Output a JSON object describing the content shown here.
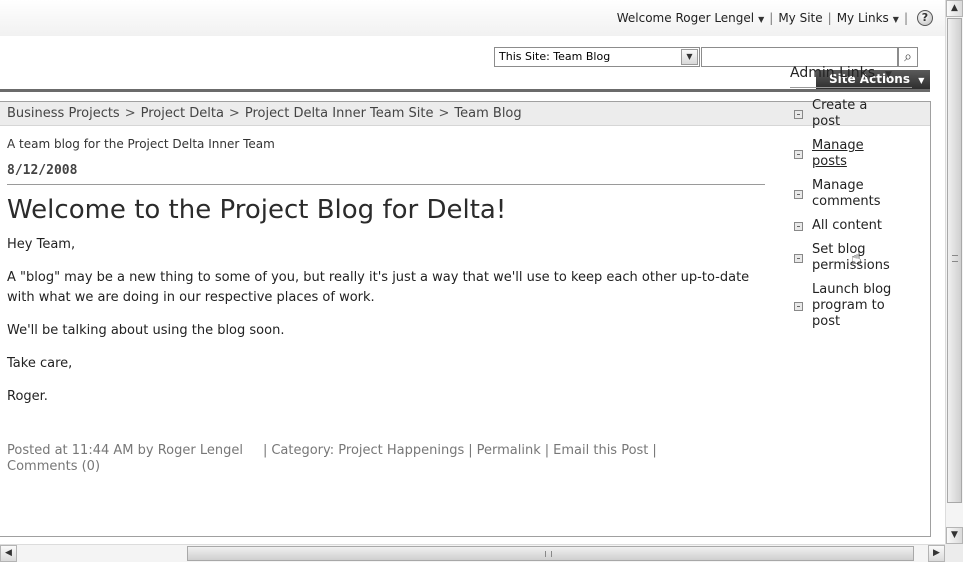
{
  "topbar": {
    "welcome_label": "Welcome Roger Lengel",
    "my_site_label": "My Site",
    "my_links_label": "My Links",
    "help_glyph": "?",
    "caret": "▼"
  },
  "search": {
    "scope_value": "This Site: Team Blog",
    "button_glyph": "⌕",
    "dropdown_glyph": "▼"
  },
  "site_actions": {
    "label": "Site Actions",
    "caret": "▼"
  },
  "breadcrumb": {
    "items": [
      "Business Projects",
      "Project Delta",
      "Project Delta Inner Team Site",
      "Team Blog"
    ],
    "separator": ">"
  },
  "site_description": "A team blog for the Project Delta Inner Team",
  "post": {
    "date": "8/12/2008",
    "title": "Welcome to the Project Blog for Delta!",
    "paragraphs": [
      "Hey Team,",
      "A \"blog\" may be a new  thing to some of you, but really it's just a way that we'll use to keep each other up-to-date with what we are doing in our respective places of work.",
      "We'll be talking about using the blog soon.",
      "Take care,",
      "Roger."
    ],
    "footer": {
      "posted": "Posted at 11:44 AM by Roger Lengel",
      "category": "Category: Project Happenings",
      "permalink": "Permalink",
      "email": "Email this Post",
      "comments": "Comments (0)"
    }
  },
  "admin_links": {
    "header": "Admin Links",
    "caret": "▼",
    "items": [
      "Create a post",
      "Manage posts",
      "Manage comments",
      "All content",
      "Set blog permissions",
      "Launch blog program to post"
    ]
  },
  "scrollbars": {
    "up": "▲",
    "down": "▼",
    "left": "◀",
    "right": "▶"
  },
  "colors": {
    "site_actions_bg": "#3c3c3c",
    "breadcrumb_bg": "#ececec"
  },
  "icons": {
    "help": "help-icon",
    "search": "search-icon",
    "cursor": "hand-cursor-icon",
    "bullet": "list-bullet-icon"
  }
}
